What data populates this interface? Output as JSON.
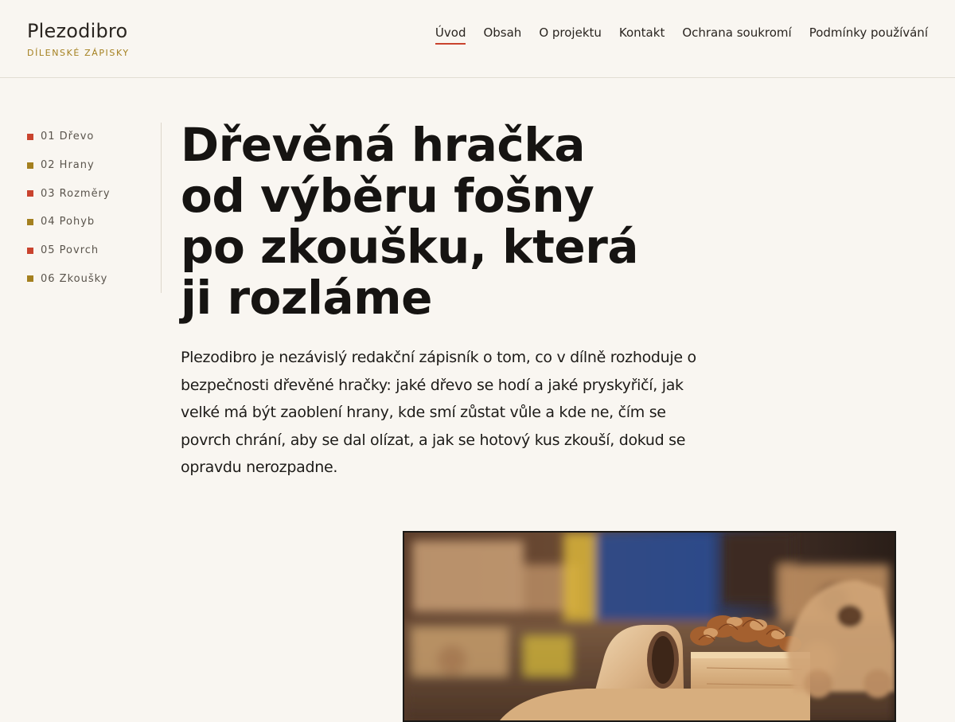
{
  "brand": {
    "name": "Plezodibro",
    "tagline": "DÍLENSKÉ ZÁPISKY"
  },
  "nav": {
    "items": [
      {
        "label": "Úvod",
        "active": true
      },
      {
        "label": "Obsah"
      },
      {
        "label": "O projektu"
      },
      {
        "label": "Kontakt"
      },
      {
        "label": "Ochrana soukromí"
      },
      {
        "label": "Podmínky používání"
      }
    ]
  },
  "toc": {
    "items": [
      {
        "label": "01 Dřevo",
        "color": "#c9432e"
      },
      {
        "label": "02 Hrany",
        "color": "#a4801f"
      },
      {
        "label": "03 Rozměry",
        "color": "#c9432e"
      },
      {
        "label": "04 Pohyb",
        "color": "#a4801f"
      },
      {
        "label": "05 Povrch",
        "color": "#c9432e"
      },
      {
        "label": "06 Zkoušky",
        "color": "#a4801f"
      }
    ]
  },
  "main": {
    "title_lines": [
      "Dřevěná hračka",
      "od výběru fošny",
      "po zkoušku, která",
      "ji rozláme"
    ],
    "lead": "Plezodibro je nezávislý redakční zápisník o tom, co v dílně rozhoduje o bezpečnosti dřevěné hračky: jaké dřevo se hodí a jaké pryskyřičí, jak velké má být zaoblení hrany, kde smí zůstat vůle a kde ne, čím se povrch chrání, aby se dal olízat, a jak se hotový kus zkouší, dokud se opravdu nerozpadne."
  },
  "colors": {
    "accent_red": "#c9432e",
    "accent_gold": "#a4801f",
    "background": "#f9f6f1"
  }
}
